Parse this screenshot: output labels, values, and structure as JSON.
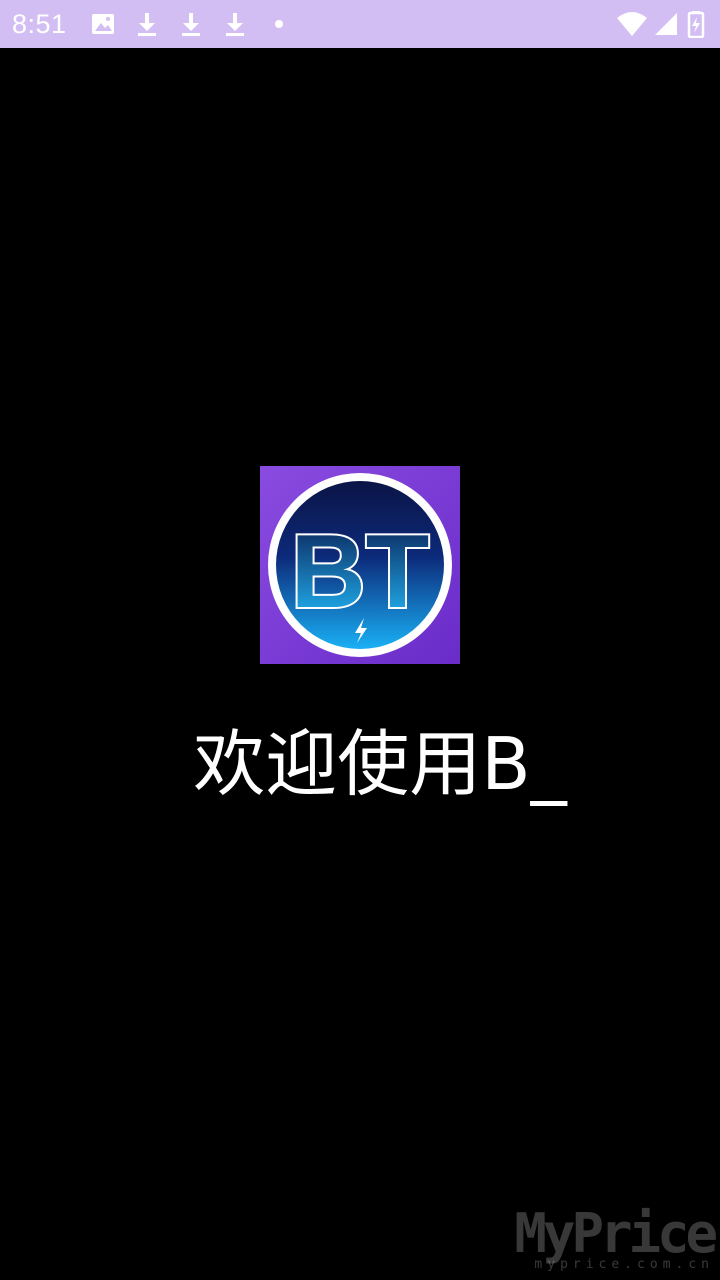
{
  "status_bar": {
    "time": "8:51",
    "left_icons": [
      "image-icon",
      "download-icon",
      "download-icon",
      "download-icon",
      "dot-icon"
    ],
    "right_icons": [
      "wifi-icon",
      "signal-icon",
      "battery-charging-icon"
    ],
    "background": "#d3bef3"
  },
  "splash": {
    "logo_text": "BT",
    "welcome_text": "欢迎使用B_",
    "background": "#000000"
  },
  "watermark": {
    "main": "MyPrice",
    "sub": "myprice.com.cn"
  },
  "colors": {
    "logo_bg": "#7b3bd8",
    "logo_circle_top": "#0a1a4e",
    "logo_circle_bottom": "#1aa0f0",
    "text": "#ffffff"
  }
}
